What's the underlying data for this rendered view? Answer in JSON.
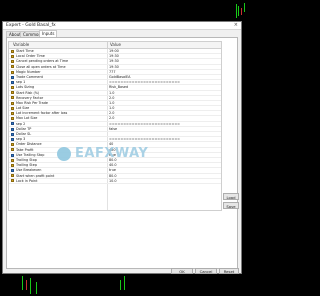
{
  "dialog": {
    "title": "Expert - Gold Basal_fx",
    "close_glyph": "×",
    "tabs": [
      "About",
      "Common",
      "Inputs"
    ],
    "active_tab": "Inputs"
  },
  "grid": {
    "col_variable": "Variable",
    "col_value": "Value",
    "rows": [
      {
        "name": "Start Time",
        "value": "19:00",
        "icon": "clock-icon"
      },
      {
        "name": "Local Order Time",
        "value": "19:30",
        "icon": "clock-icon"
      },
      {
        "name": "Cancel pending orders at Time",
        "value": "19:30",
        "icon": "clock-icon"
      },
      {
        "name": "Close all open orders at Time",
        "value": "19:30",
        "icon": "clock-icon"
      },
      {
        "name": "Magic Number",
        "value": "777",
        "icon": "number-icon"
      },
      {
        "name": "Trade Comment",
        "value": "GoldBasalEA",
        "icon": "text-icon"
      },
      {
        "name": "sep 1",
        "value": "=========================",
        "icon": "text-icon"
      },
      {
        "name": "Lots Sizing",
        "value": "Risk_Based",
        "icon": "list-icon"
      },
      {
        "name": "Start Risk (%)",
        "value": "1.0",
        "icon": "number-icon"
      },
      {
        "name": "Recovery Factor",
        "value": "2.0",
        "icon": "number-icon"
      },
      {
        "name": "Max Risk Per Trade",
        "value": "1.0",
        "icon": "number-icon"
      },
      {
        "name": "Lot Size",
        "value": "1.0",
        "icon": "number-icon"
      },
      {
        "name": "Lot increment factor after loss",
        "value": "2.0",
        "icon": "number-icon"
      },
      {
        "name": "Max Lot Size",
        "value": "2.0",
        "icon": "number-icon"
      },
      {
        "name": "sep 2",
        "value": "=========================",
        "icon": "text-icon"
      },
      {
        "name": "Dollar TP",
        "value": "false",
        "icon": "bool-icon"
      },
      {
        "name": "Dollar SL",
        "value": "",
        "icon": "bool-icon"
      },
      {
        "name": "sep 3",
        "value": "=========================",
        "icon": "text-icon"
      },
      {
        "name": "Order Distance",
        "value": "40",
        "icon": "number-icon"
      },
      {
        "name": "Take Profit",
        "value": "400",
        "icon": "number-icon"
      },
      {
        "name": "Use Trailing Stop",
        "value": "true",
        "icon": "bool-icon"
      },
      {
        "name": "Trailing Stop",
        "value": "80.0",
        "icon": "number-icon"
      },
      {
        "name": "Trailing Step",
        "value": "40.0",
        "icon": "number-icon"
      },
      {
        "name": "Use Breakeven",
        "value": "true",
        "icon": "bool-icon"
      },
      {
        "name": "Start when profit point",
        "value": "80.0",
        "icon": "number-icon"
      },
      {
        "name": "Lock in Point",
        "value": "10.0",
        "icon": "number-icon"
      }
    ]
  },
  "watermark": {
    "text": "EAFXWAY"
  },
  "buttons": {
    "load": "Load",
    "save": "Save",
    "ok": "OK",
    "cancel": "Cancel",
    "reset": "Reset"
  },
  "colors": {
    "bull": "#18c818",
    "bear": "#c83030",
    "accent": "#d9a520"
  }
}
